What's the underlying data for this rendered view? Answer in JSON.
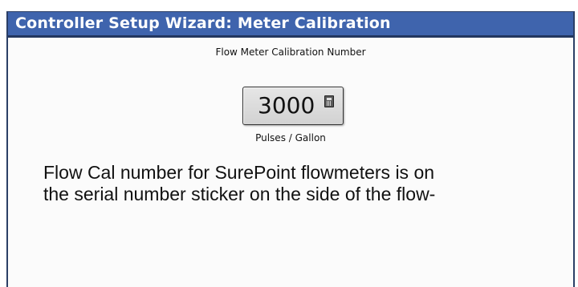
{
  "window": {
    "title": "Controller Setup Wizard:  Meter Calibration"
  },
  "calibration": {
    "field_label": "Flow Meter Calibration Number",
    "value": "3000",
    "units": "Pulses / Gallon",
    "edit_icon": "calculator-icon"
  },
  "info": {
    "line1": "Flow Cal number for SurePoint flowmeters is on",
    "line2": "the serial number sticker on the side of the flow-"
  },
  "colors": {
    "titlebar": "#3f64ad",
    "titlebar_border": "#23375f",
    "background": "#fbfbfb",
    "button_face": "#dcdcdc"
  }
}
